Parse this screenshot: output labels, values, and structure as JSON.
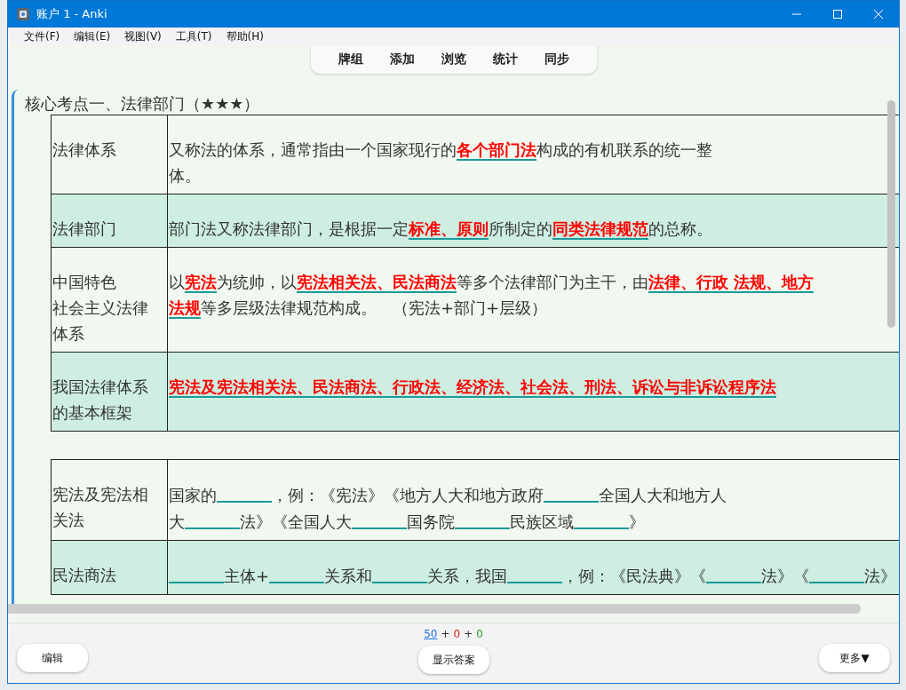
{
  "window": {
    "title": "账户 1 - Anki"
  },
  "menu": [
    "文件(F)",
    "编辑(E)",
    "视图(V)",
    "工具(T)",
    "帮助(H)"
  ],
  "nav": [
    "牌组",
    "添加",
    "浏览",
    "统计",
    "同步"
  ],
  "card": {
    "title": "核心考点一、法律部门（★★★）",
    "tables": [
      {
        "rows": [
          {
            "shaded": false,
            "label_lines": [
              "法律体系"
            ],
            "lines": [
              [
                {
                  "kind": "text",
                  "text": "又称法的体系，通常指由一个国家现行的"
                },
                {
                  "kind": "key",
                  "text": "各个部门法"
                },
                {
                  "kind": "text",
                  "text": "构成的有机联系的统一整"
                }
              ],
              [
                {
                  "kind": "text",
                  "text": "体。"
                }
              ]
            ]
          },
          {
            "shaded": true,
            "label_lines": [
              "法律部门"
            ],
            "lines": [
              [
                {
                  "kind": "text",
                  "text": "部门法又称法律部门，是根据一定"
                },
                {
                  "kind": "key",
                  "text": "标准、原则"
                },
                {
                  "kind": "text",
                  "text": "所制定的"
                },
                {
                  "kind": "key",
                  "text": "同类法律规范"
                },
                {
                  "kind": "text",
                  "text": "的总称。"
                }
              ]
            ]
          },
          {
            "shaded": false,
            "label_lines": [
              "中国特色",
              "社会主义法律",
              "体系"
            ],
            "lines": [
              [
                {
                  "kind": "text",
                  "text": "以"
                },
                {
                  "kind": "key",
                  "text": "宪法"
                },
                {
                  "kind": "text",
                  "text": "为统帅，以"
                },
                {
                  "kind": "key",
                  "text": "宪法相关法、民法商法"
                },
                {
                  "kind": "text",
                  "text": "等多个法律部门为主干，由"
                },
                {
                  "kind": "key",
                  "text": "法律、行政 法规、地方"
                }
              ],
              [
                {
                  "kind": "key",
                  "text": "法规"
                },
                {
                  "kind": "text",
                  "text": "等多层级法律规范构成。　（宪法+部门+层级）"
                }
              ]
            ]
          },
          {
            "shaded": true,
            "label_lines": [
              "我国法律体系",
              "的基本框架"
            ],
            "lines": [
              [
                {
                  "kind": "key",
                  "text": "宪法及宪法相关法、民法商法、行政法、经济法、社会法、刑法、诉讼与非诉讼程序法"
                }
              ]
            ]
          }
        ]
      },
      {
        "rows": [
          {
            "shaded": false,
            "label_lines": [
              "宪法及宪法相",
              "关法"
            ],
            "lines": [
              [
                {
                  "kind": "text",
                  "text": "国家的"
                },
                {
                  "kind": "blank"
                },
                {
                  "kind": "text",
                  "text": "，例：《宪法》《地方人大和地方政府"
                },
                {
                  "kind": "blank"
                },
                {
                  "kind": "text",
                  "text": "全国人大和地方人"
                }
              ],
              [
                {
                  "kind": "text",
                  "text": "大"
                },
                {
                  "kind": "blank"
                },
                {
                  "kind": "text",
                  "text": "法》《全国人大"
                },
                {
                  "kind": "blank"
                },
                {
                  "kind": "text",
                  "text": "国务院"
                },
                {
                  "kind": "blank"
                },
                {
                  "kind": "text",
                  "text": "民族区域"
                },
                {
                  "kind": "blank"
                },
                {
                  "kind": "text",
                  "text": "》"
                }
              ]
            ]
          },
          {
            "shaded": true,
            "label_lines": [
              "民法商法"
            ],
            "lines": [
              [
                {
                  "kind": "blank"
                },
                {
                  "kind": "text",
                  "text": "主体+"
                },
                {
                  "kind": "blank"
                },
                {
                  "kind": "text",
                  "text": "关系和"
                },
                {
                  "kind": "blank"
                },
                {
                  "kind": "text",
                  "text": "关系，我国"
                },
                {
                  "kind": "blank"
                },
                {
                  "kind": "text",
                  "text": "，例：《民法典》《"
                },
                {
                  "kind": "blank"
                },
                {
                  "kind": "text",
                  "text": "法》《"
                },
                {
                  "kind": "blank"
                },
                {
                  "kind": "text",
                  "text": "法》"
                }
              ]
            ]
          }
        ]
      }
    ]
  },
  "counts": [
    {
      "text": "50",
      "kind": "new"
    },
    {
      "text": "+",
      "kind": "sep"
    },
    {
      "text": "0",
      "kind": "learn"
    },
    {
      "text": "+",
      "kind": "sep"
    },
    {
      "text": "0",
      "kind": "review"
    }
  ],
  "buttons": {
    "left": "编辑",
    "center": "显示答案",
    "right": "更多▼"
  }
}
